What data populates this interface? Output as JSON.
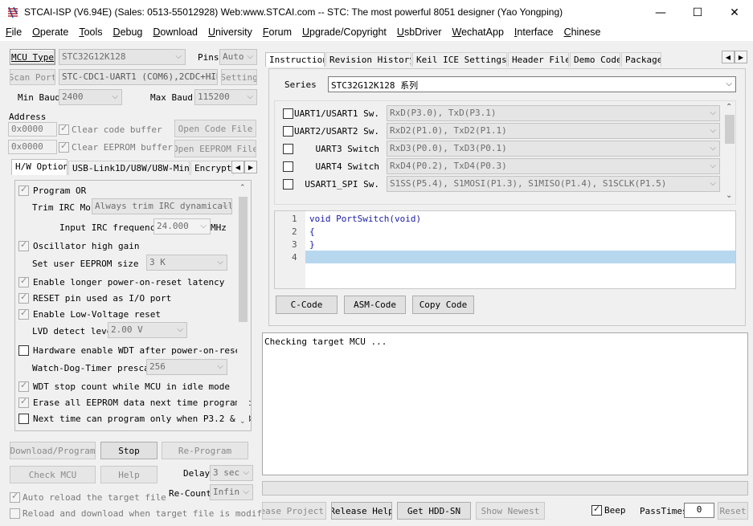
{
  "window": {
    "title": "STCAI-ISP (V6.94E) (Sales: 0513-55012928) Web:www.STCAI.com  -- STC: The most powerful 8051 designer (Yao Yongping)",
    "minimize": "—",
    "maximize": "☐",
    "close": "✕"
  },
  "menu": [
    "File",
    "Operate",
    "Tools",
    "Debug",
    "Download",
    "University",
    "Forum",
    "Upgrade/Copyright",
    "UsbDriver",
    "WechatApp",
    "Interface",
    "Chinese"
  ],
  "left": {
    "mcu_type_label": "MCU Type",
    "mcu_type_value": "STC32G12K128",
    "pins_label": "Pins",
    "pins_value": "Auto",
    "scan_port_label": "Scan Port",
    "port_value": "STC-CDC1-UART1 (COM6),2CDC+HID",
    "setting_label": "Setting",
    "min_baud_label": "Min Baud",
    "min_baud_value": "2400",
    "max_baud_label": "Max Baud",
    "max_baud_value": "115200",
    "address_label": "Address",
    "code_addr": "0x0000",
    "eeprom_addr": "0x0000",
    "clear_code_label": "Clear code buffer",
    "clear_eeprom_label": "Clear EEPROM buffer",
    "open_code_label": "Open Code File",
    "open_eeprom_label": "Open EEPROM File",
    "tabs": [
      "H/W Option",
      "USB-Link1D/U8W/U8W-Mini",
      "Encrypti"
    ],
    "options": {
      "program_or": "Program OR",
      "trim_irc_label": "Trim IRC Mo",
      "trim_irc_value": "Always trim IRC dynamically",
      "irc_freq_label": "Input IRC frequency",
      "irc_freq_value": "24.000",
      "irc_freq_unit": "MHz",
      "osc_gain": "Oscillator high gain",
      "eeprom_size_label": "Set user EEPROM size",
      "eeprom_size_value": "3    K",
      "longer_reset": "Enable longer power-on-reset latency",
      "reset_pin": "RESET pin used as I/O port",
      "lvd_reset": "Enable Low-Voltage reset",
      "lvd_level_label": "LVD detect leve",
      "lvd_level_value": "2.00 V",
      "hw_wdt": "Hardware enable WDT after power-on-reset",
      "wdt_prescale_label": "Watch-Dog-Timer prescal",
      "wdt_prescale_value": "256",
      "wdt_idle": "WDT stop count while MCU in idle mode",
      "erase_eeprom": "Erase all EEPROM data next time program c",
      "next_time": "Next time can program only when P3.2 & P3"
    },
    "download_label": "Download/Program",
    "stop_label": "Stop",
    "reprogram_label": "Re-Program",
    "check_mcu_label": "Check MCU",
    "help_label": "Help",
    "delay_label": "Delay",
    "delay_value": "3 sec",
    "recount_label": "Re-Count",
    "recount_value": "Infin",
    "auto_reload_label": "Auto reload the target file",
    "reload_download_label": "Reload and download when target file is modified"
  },
  "right": {
    "tabs": [
      "Instruction",
      "Revision History",
      "Keil ICE Settings",
      "Header File",
      "Demo Code",
      "Package"
    ],
    "series_label": "Series",
    "series_value": "STC32G12K128 系列",
    "ports": [
      {
        "label": "UART1/USART1 Sw.",
        "value": "RxD(P3.0), TxD(P3.1)"
      },
      {
        "label": "UART2/USART2 Sw.",
        "value": "RxD2(P1.0), TxD2(P1.1)"
      },
      {
        "label": "UART3 Switch",
        "value": "RxD3(P0.0), TxD3(P0.1)"
      },
      {
        "label": "UART4 Switch",
        "value": "RxD4(P0.2), TxD4(P0.3)"
      },
      {
        "label": "USART1_SPI Sw.",
        "value": "S1SS(P5.4), S1MOSI(P1.3), S1MISO(P1.4), S1SCLK(P1.5)"
      }
    ],
    "code_lines": [
      {
        "num": "1",
        "text": "void PortSwitch(void)"
      },
      {
        "num": "2",
        "text": "{"
      },
      {
        "num": "3",
        "text": "}"
      },
      {
        "num": "4",
        "text": ""
      }
    ],
    "c_code_label": "C-Code",
    "asm_code_label": "ASM-Code",
    "copy_code_label": "Copy Code",
    "log_text": "Checking target MCU ...",
    "release_project_label": "Release Project",
    "release_help_label": "Release Help",
    "get_hdd_label": "Get HDD-SN",
    "show_newest_label": "Show Newest",
    "beep_label": "Beep",
    "pass_times_label": "PassTimes",
    "pass_times_value": "0",
    "reset_label": "Reset"
  }
}
